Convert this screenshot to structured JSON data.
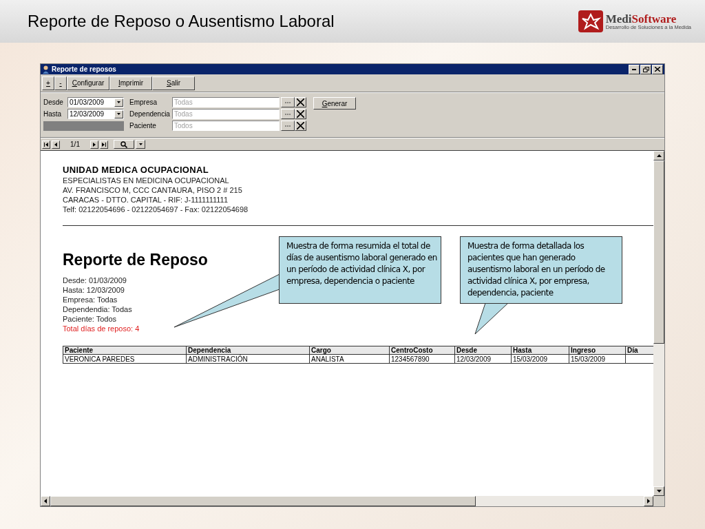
{
  "slide": {
    "title": "Reporte de Reposo o Ausentismo Laboral",
    "logo": {
      "name_a": "Medi",
      "name_b": "Software",
      "tagline": "Desarrollo de Soluciones a la Medida"
    }
  },
  "window": {
    "title": "Reporte de reposos",
    "toolbar": [
      {
        "label": "+",
        "kind": "small"
      },
      {
        "label": "-",
        "kind": "small"
      },
      {
        "label": "Configurar",
        "kind": "wide"
      },
      {
        "label": "Imprimir",
        "kind": "wide"
      },
      {
        "label": "Salir",
        "kind": "wide"
      }
    ],
    "dates": [
      {
        "label": "Desde",
        "value": "01/03/2009"
      },
      {
        "label": "Hasta",
        "value": "12/03/2009"
      }
    ],
    "lookups": [
      {
        "label": "Empresa",
        "placeholder": "Todas"
      },
      {
        "label": "Dependencia",
        "placeholder": "Todas"
      },
      {
        "label": "Paciente",
        "placeholder": "Todos"
      }
    ],
    "generate_button": "Generar",
    "pager": {
      "page": "1/1"
    },
    "report": {
      "company": "UNIDAD MEDICA OCUPACIONAL",
      "header_lines": [
        "ESPECIALISTAS EN MEDICINA OCUPACIONAL",
        "AV. FRANCISCO M, CCC CANTAURA, PISO 2 # 215",
        "CARACAS - DTTO. CAPITAL - RIF: J-1111111111",
        "Telf: 02122054696 - 02122054697 - Fax: 02122054698"
      ],
      "title": "Reporte de Reposo",
      "criteria": [
        "Desde: 01/03/2009",
        "Hasta: 12/03/2009",
        "Empresa: Todas",
        "Dependendia: Todas",
        "Paciente: Todos"
      ],
      "total": "Total días de reposo: 4",
      "table": {
        "columns": [
          "Paciente",
          "Dependencia",
          "Cargo",
          "CentroCosto",
          "Desde",
          "Hasta",
          "Ingreso",
          "Día"
        ],
        "rows": [
          [
            "VERONICA PAREDES",
            "ADMINISTRACIÓN",
            "ANALISTA",
            "1234567890",
            "12/03/2009",
            "15/03/2009",
            "15/03/2009"
          ]
        ]
      }
    }
  },
  "callouts": [
    {
      "text": "Muestra de forma resumida el total de días de ausentismo laboral generado en un período de actividad clínica X, por empresa, dependencia o paciente"
    },
    {
      "text": "Muestra de forma detallada los pacientes que han generado ausentismo laboral en un período de actividad clínica X, por empresa, dependencia, paciente"
    }
  ]
}
